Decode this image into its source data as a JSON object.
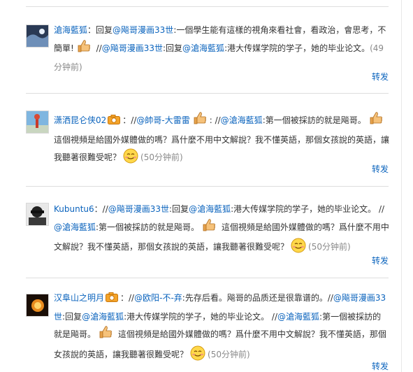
{
  "feed": {
    "repost_label": "转发",
    "posts": [
      {
        "username": "滄海藍狐",
        "sep1": "：回复",
        "m1": "@飚哥漫画33世",
        "t1": ":一個學生能有這樣的視角來看社會，看政治，會思考，不簡單!",
        "t2": " //",
        "m2": "@飚哥漫画33世",
        "t3": ":回复",
        "m3": "@滄海藍狐",
        "t4": ":港大传媒学院的学子，她的毕业论文。",
        "time": "(49分钟前)"
      },
      {
        "username": "潇洒昆仑侠02",
        "sep1": "：//",
        "m1": "@帥哥-大雷雷",
        "t1": ": //",
        "m2": "@滄海藍狐",
        "t2": ":第一個被採訪的就是飚哥。",
        "t3": " 這個視頻是給國外媒體做的嗎？爲什麼不用中文解說？我不懂英語，那個女孩說的英語，讓我聽著很難受呢？",
        "time": "(50分钟前)"
      },
      {
        "username": "Kubuntu6",
        "sep1": "：//",
        "m1": "@飚哥漫画33世",
        "t1": ":回复",
        "m2": "@滄海藍狐",
        "t2": ":港大传媒学院的学子，她的毕业论文。 //",
        "m3": "@滄海藍狐",
        "t3": ":第一個被採訪的就是飚哥。",
        "t4": " 這個視頻是給國外媒體做的嗎？爲什麼不用中文解說？我不懂英語，那個女孩說的英語，讓我聽著很難受呢？",
        "time": "(50分钟前)"
      },
      {
        "username": "汉阜山之明月",
        "sep1": "：//",
        "m1": "@欧阳-不-弃",
        "t1": ":先存后看。飚哥的品质还是很靠谱的。//",
        "m2": "@飚哥漫画33世",
        "t2": ":回复",
        "m3": "@滄海藍狐",
        "t3": ":港大传媒学院的学子，她的毕业论文。 //",
        "m4": "@滄海藍狐",
        "t4": ":第一個被採訪的就是飚哥。",
        "t5": " 這個視頻是給國外媒體做的嗎？爲什麼不用中文解說？我不懂英語，那個女孩說的英語，讓我聽著很難受呢？",
        "time": "(50分钟前)"
      }
    ]
  }
}
